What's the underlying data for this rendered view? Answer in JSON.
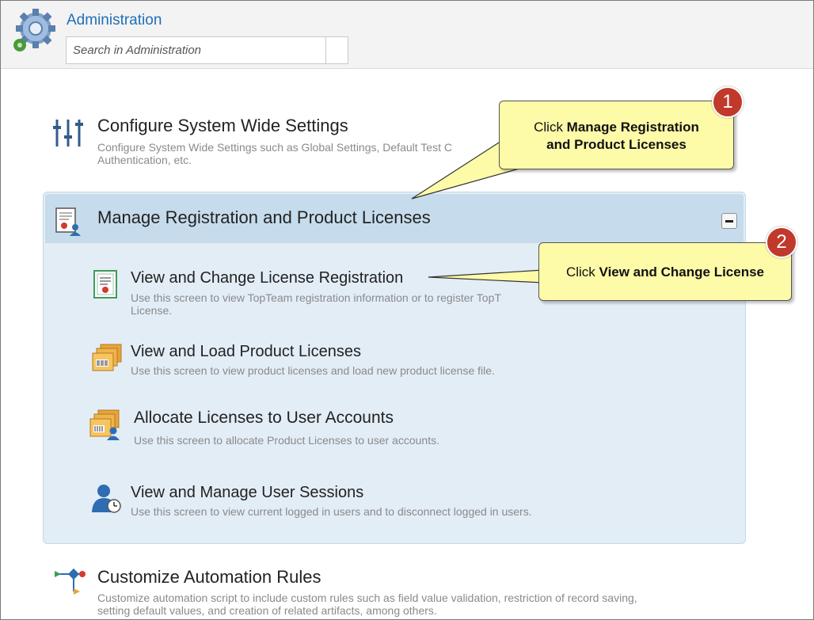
{
  "header": {
    "app_title": "Administration",
    "search_placeholder": "Search in Administration"
  },
  "sections": {
    "configure": {
      "title": "Configure System Wide Settings",
      "description_line1": "Configure System Wide Settings such as Global Settings, Default Test C",
      "description_line2": "Authentication, etc."
    },
    "manage_registration": {
      "title": "Manage Registration and Product Licenses",
      "items": [
        {
          "title": "View and Change License Registration",
          "description_line1": "Use this screen to view TopTeam registration information or to register TopT",
          "description_line2": "License."
        },
        {
          "title": "View and Load Product Licenses",
          "description_line1": "Use this screen to view product licenses and load new product license file."
        },
        {
          "title": "Allocate Licenses to User Accounts",
          "description_line1": "Use this screen to allocate Product Licenses to user accounts."
        },
        {
          "title": "View and Manage User Sessions",
          "description_line1": "Use this screen to view current logged in users and to disconnect logged in users."
        }
      ]
    },
    "automation": {
      "title": "Customize Automation Rules",
      "description_line1": "Customize automation script to include custom rules such as field value validation, restriction of record saving,",
      "description_line2": "setting default values, and creation of related artifacts, among others."
    }
  },
  "callouts": [
    {
      "badge": "1",
      "prefix": "Click ",
      "bold_line1": "Manage Registration",
      "bold_line2": "and Product Licenses"
    },
    {
      "badge": "2",
      "prefix": "Click ",
      "bold": "View and Change License"
    }
  ],
  "colors": {
    "title_blue": "#1f6fb6",
    "panel_bg": "#e3edf6",
    "panel_header_bg": "#c6dcec",
    "callout_bg": "#fdfaa8",
    "badge_red": "#c0392b"
  },
  "icons": [
    "gear-icon",
    "sliders-icon",
    "certificate-user-icon",
    "certificate-icon",
    "license-boxes-icon",
    "license-boxes-user-icon",
    "user-clock-icon",
    "workflow-icon",
    "collapse-icon"
  ]
}
